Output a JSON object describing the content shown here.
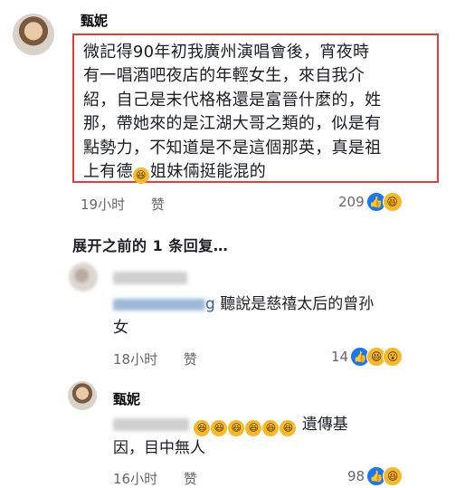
{
  "main_comment": {
    "author": "甄妮",
    "text_lines": [
      "微記得90年初我廣州演唱會後，宵夜時",
      "有一唱酒吧夜店的年輕女生，來自我介",
      "紹，自己是末代格格還是富晉什麼的，姓",
      "那，帶她來的是江湖大哥之類的，似是有",
      "點勢力，不知道是不是這個那英，真是祖"
    ],
    "last_line_prefix": "上有德",
    "last_line_suffix": "姐妹倆挺能混的",
    "time": "19小时",
    "like_label": "赞",
    "reaction_count": "209"
  },
  "expand_replies": "展开之前的 1 条回复…",
  "reply1": {
    "tag_tail": "g",
    "text_line1": " 聽說是慈禧太后的曾孙",
    "text_line2": "女",
    "time": "18小时",
    "like_label": "赞",
    "reaction_count": "14"
  },
  "reply2": {
    "author": "甄妮",
    "text_suffix": "遺傳基",
    "text_line2": "因，目中無人",
    "time": "16小时",
    "like_label": "赞",
    "reaction_count": "98"
  },
  "icons": {
    "like": "like-reaction-icon",
    "haha": "haha-reaction-icon",
    "wow": "wow-reaction-icon",
    "laugh_emoji": "rolling-laugh-emoji"
  },
  "colors": {
    "highlight_box": "#e23b3b",
    "like_blue": "#1877f2",
    "emoji_yellow": "#f7b928",
    "meta_gray": "#65676b"
  }
}
